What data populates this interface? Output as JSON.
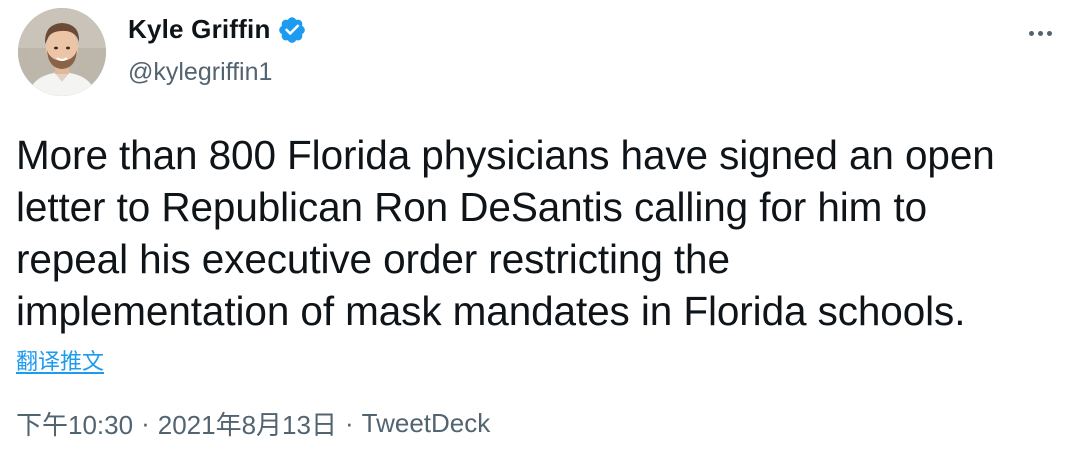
{
  "author": {
    "display_name": "Kyle Griffin",
    "handle": "@kylegriffin1",
    "verified": true
  },
  "icons": {
    "avatar": "profile-photo",
    "verified": "verified-badge-icon",
    "more": "more-options-icon"
  },
  "colors": {
    "text": "#0f1419",
    "secondary": "#536471",
    "accent": "#1d9bf0"
  },
  "tweet": {
    "text": "More than 800 Florida physicians have signed an open\nletter to Republican Ron DeSantis calling for him to\nrepeal his executive order restricting the\nimplementation of mask mandates in Florida schools.",
    "translate_label": "翻译推文"
  },
  "meta": {
    "time": "下午10:30",
    "date": "2021年8月13日",
    "separator": "·",
    "source": "TweetDeck"
  }
}
